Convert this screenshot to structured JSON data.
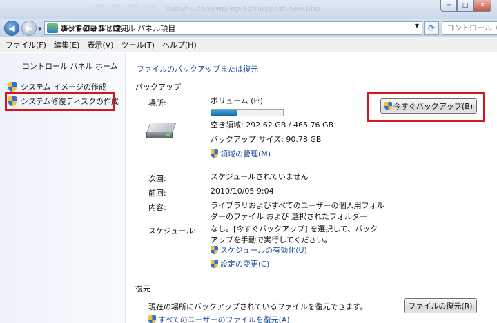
{
  "window": {
    "faded_address": "xuhuhu.com/wp/wp-admin/post-new.php",
    "controls": {
      "minimize": "─",
      "maximize": "□",
      "close": "✕"
    }
  },
  "address_bar": {
    "back": "◀",
    "forward": "▶",
    "crumbs": [
      "コントロール パネル",
      "すべてのコントロール パネル項目",
      "バックアップと復元"
    ],
    "search_placeholder": "コントロール パネルの検索"
  },
  "menu": [
    "ファイル(F)",
    "編集(E)",
    "表示(V)",
    "ツール(T)",
    "ヘルプ(H)"
  ],
  "left_pane": {
    "home": "コントロール パネル ホーム",
    "links": [
      "システム イメージの作成",
      "システム修復ディスクの作成"
    ]
  },
  "main": {
    "title": "ファイルのバックアップまたは復元",
    "backup_section": "バックアップ",
    "location_label": "場所:",
    "volume": "ボリューム (F:)",
    "volume_used_fraction": 0.37,
    "free_space": "空き領域: 292.62 GB / 465.76 GB",
    "backup_size": "バックアップ サイズ: 90.78 GB",
    "manage_space": "領域の管理(M)",
    "backup_now": "今すぐバックアップ(B)",
    "next_label": "次回:",
    "next_value": "スケジュールされていません",
    "last_label": "前回:",
    "last_value": "2010/10/05 9:04",
    "contents_label": "内容:",
    "contents_value_1": "ライブラリおよびすべてのユーザーの個人用フォル",
    "contents_value_2": "ダーのファイル および 選択されたフォルダー",
    "schedule_label": "スケジュール:",
    "schedule_value_1": "なし。[今すぐバックアップ] を選択して、バック",
    "schedule_value_2": "アップを手動で実行してください。",
    "enable_schedule": "スケジュールの有効化(U)",
    "change_settings": "設定の変更(C)",
    "restore_section": "復元",
    "restore_text": "現在の場所にバックアップされているファイルを復元できます。",
    "restore_button": "ファイルの復元(R)",
    "restore_all_users": "すべてのユーザーのファイルを復元(A)"
  },
  "colors": {
    "highlight_box": "#d8141c",
    "link": "#1f4e9a"
  }
}
